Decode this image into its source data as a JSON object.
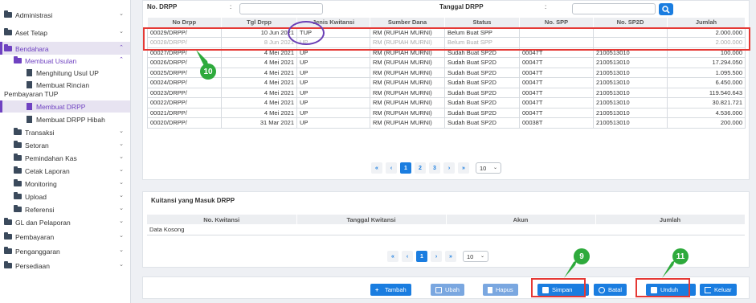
{
  "sidebar": {
    "items": [
      {
        "label": "Administrasi"
      },
      {
        "label": "Aset Tetap"
      },
      {
        "label": "Bendahara"
      },
      {
        "label": "Membuat Usulan"
      },
      {
        "label": "Menghitung Usul UP"
      },
      {
        "label": "Membuat Rincian"
      },
      {
        "label": "Pembayaran TUP"
      },
      {
        "label": "Membuat DRPP"
      },
      {
        "label": "Membuat DRPP Hibah"
      },
      {
        "label": "Transaksi"
      },
      {
        "label": "Setoran"
      },
      {
        "label": "Pemindahan Kas"
      },
      {
        "label": "Cetak Laporan"
      },
      {
        "label": "Monitoring"
      },
      {
        "label": "Upload"
      },
      {
        "label": "Referensi"
      },
      {
        "label": "GL dan Pelaporan"
      },
      {
        "label": "Pembayaran"
      },
      {
        "label": "Penganggaran"
      },
      {
        "label": "Persediaan"
      }
    ]
  },
  "filter": {
    "no_drpp_label": "No. DRPP",
    "tanggal_label": "Tanggal DRPP",
    "colon": ":"
  },
  "table": {
    "headers": [
      "No Drpp",
      "Tgl Drpp",
      "Jenis Kwitansi",
      "Sumber Dana",
      "Status",
      "No. SPP",
      "No. SP2D",
      "Jumlah"
    ],
    "rows": [
      [
        "00029/DRPP/",
        "10 Jun 2021",
        "TUP",
        "RM (RUPIAH MURNI)",
        "Belum Buat SPP",
        "",
        "",
        "2.000.000"
      ],
      [
        "00028/DRPP/",
        "8 Jun 2021",
        "UP",
        "RM (RUPIAH MURNI)",
        "Belum Buat SPP",
        "",
        "",
        "2.000.000"
      ],
      [
        "00027/DRPP/",
        "4 Mei 2021",
        "UP",
        "RM (RUPIAH MURNI)",
        "Sudah Buat SP2D",
        "00047T",
        "2100513010",
        "100.000"
      ],
      [
        "00026/DRPP/",
        "4 Mei 2021",
        "UP",
        "RM (RUPIAH MURNI)",
        "Sudah Buat SP2D",
        "00047T",
        "2100513010",
        "17.294.050"
      ],
      [
        "00025/DRPP/",
        "4 Mei 2021",
        "UP",
        "RM (RUPIAH MURNI)",
        "Sudah Buat SP2D",
        "00047T",
        "2100513010",
        "1.095.500"
      ],
      [
        "00024/DRPP/",
        "4 Mei 2021",
        "UP",
        "RM (RUPIAH MURNI)",
        "Sudah Buat SP2D",
        "00047T",
        "2100513010",
        "6.450.000"
      ],
      [
        "00023/DRPP/",
        "4 Mei 2021",
        "UP",
        "RM (RUPIAH MURNI)",
        "Sudah Buat SP2D",
        "00047T",
        "2100513010",
        "119.540.643"
      ],
      [
        "00022/DRPP/",
        "4 Mei 2021",
        "UP",
        "RM (RUPIAH MURNI)",
        "Sudah Buat SP2D",
        "00047T",
        "2100513010",
        "30.821.721"
      ],
      [
        "00021/DRPP/",
        "4 Mei 2021",
        "UP",
        "RM (RUPIAH MURNI)",
        "Sudah Buat SP2D",
        "00047T",
        "2100513010",
        "4.536.000"
      ],
      [
        "00020/DRPP/",
        "31 Mar 2021",
        "UP",
        "RM (RUPIAH MURNI)",
        "Sudah Buat SP2D",
        "00038T",
        "2100513010",
        "200.000"
      ]
    ]
  },
  "pager": {
    "first": "«",
    "prev": "‹",
    "pages": [
      "1",
      "2",
      "3"
    ],
    "next": "›",
    "last": "»",
    "per_page": "10"
  },
  "kwitansi": {
    "title": "Kuitansi yang Masuk DRPP",
    "headers": [
      "No. Kwitansi",
      "Tanggal Kwitansi",
      "Akun",
      "Jumlah"
    ],
    "empty": "Data Kosong"
  },
  "pager2": {
    "first": "«",
    "prev": "‹",
    "page": "1",
    "next": "›",
    "last": "»",
    "per_page": "10"
  },
  "buttons": {
    "tambah": "Tambah",
    "ubah": "Ubah",
    "hapus": "Hapus",
    "simpan": "Simpan",
    "batal": "Batal",
    "unduh": "Unduh",
    "keluar": "Keluar"
  },
  "annotations": {
    "step9": "9",
    "step10": "10",
    "step11": "11"
  },
  "colors": {
    "accent": "#6f42c1",
    "primary": "#1a7de0",
    "annotation_red": "#e53935",
    "badge_green": "#2eaa3c"
  }
}
